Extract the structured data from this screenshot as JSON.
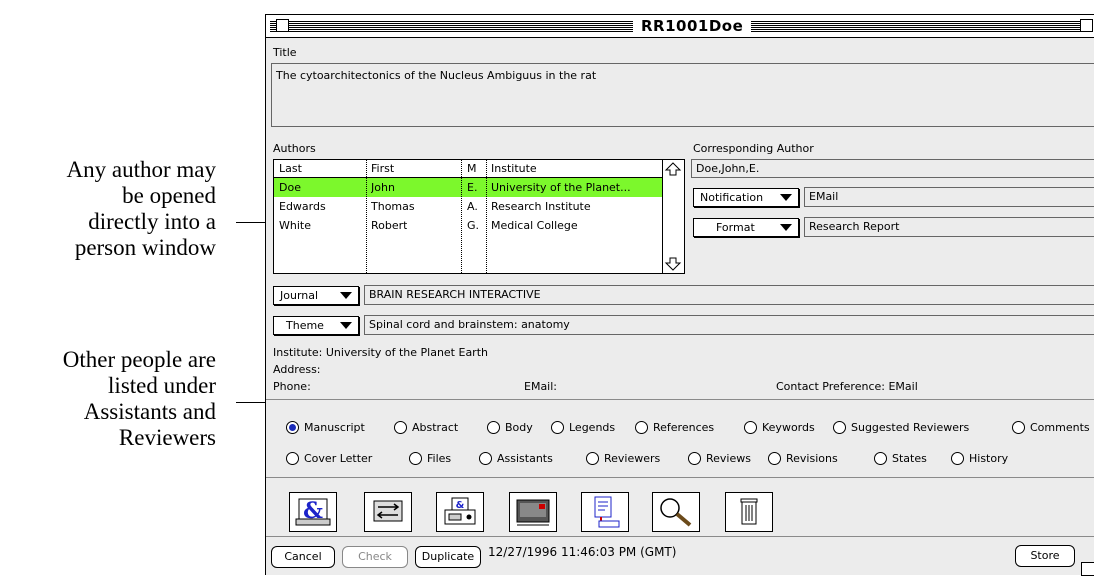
{
  "annotations": {
    "author": [
      "Any author may",
      "be opened",
      "directly into a",
      "person window"
    ],
    "others": [
      "Other people are",
      "listed under",
      "Assistants and",
      "Reviewers"
    ]
  },
  "window": {
    "title": "RR1001Doe"
  },
  "title_section": {
    "label": "Title",
    "value": "The cytoarchitectonics of the Nucleus Ambiguus in the rat"
  },
  "authors": {
    "label": "Authors",
    "columns": [
      "Last",
      "First",
      "M",
      "Institute"
    ],
    "rows": [
      {
        "last": "Doe",
        "first": "John",
        "m": "E.",
        "institute": "University of the Planet..."
      },
      {
        "last": "Edwards",
        "first": "Thomas",
        "m": "A.",
        "institute": "Research Institute"
      },
      {
        "last": "White",
        "first": "Robert",
        "m": "G.",
        "institute": "Medical College"
      }
    ],
    "selected_color": "#7cf82c"
  },
  "corresponding": {
    "label": "Corresponding Author",
    "value": "Doe,John,E.",
    "notification_label": "Notification",
    "notification_value": "EMail",
    "format_label": "Format",
    "format_value": "Research Report"
  },
  "journal": {
    "label": "Journal",
    "value": "BRAIN RESEARCH INTERACTIVE"
  },
  "theme": {
    "label": "Theme",
    "value": "Spinal cord and brainstem: anatomy"
  },
  "info": {
    "institute": "Institute: University of the Planet Earth",
    "address": "Address:",
    "phone": "Phone:",
    "email": "EMail:",
    "contact": "Contact Preference: EMail"
  },
  "sections_row1": [
    "Manuscript",
    "Abstract",
    "Body",
    "Legends",
    "References",
    "Keywords",
    "Suggested Reviewers",
    "Comments"
  ],
  "sections_row2": [
    "Cover Letter",
    "Files",
    "Assistants",
    "Reviewers",
    "Reviews",
    "Revisions",
    "States",
    "History"
  ],
  "selected_section": "Manuscript",
  "toolbar_icons": [
    "ampersand-icon",
    "transfer-icon",
    "fax-icon",
    "mail-icon",
    "document-arrow-icon",
    "magnifier-icon",
    "trash-icon"
  ],
  "footer": {
    "cancel": "Cancel",
    "check": "Check",
    "duplicate": "Duplicate",
    "timestamp": "12/27/1996 11:46:03 PM (GMT)",
    "store": "Store"
  }
}
